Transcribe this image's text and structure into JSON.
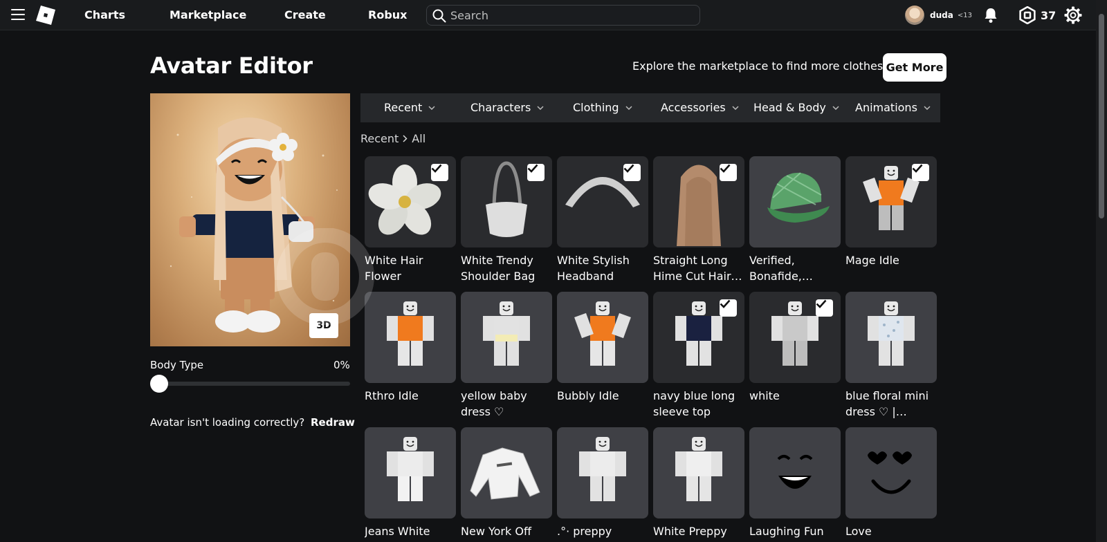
{
  "nav": {
    "links": [
      "Charts",
      "Marketplace",
      "Create",
      "Robux"
    ],
    "search_placeholder": "Search",
    "username": "duda",
    "age_tag": "<13",
    "robux_count": "37"
  },
  "header": {
    "title": "Avatar Editor",
    "explore_text": "Explore the marketplace to find more clothes!",
    "get_more_label": "Get More"
  },
  "preview": {
    "mode_button": "3D",
    "body_type_label": "Body Type",
    "body_type_value": "0%",
    "body_type_level": 0,
    "redraw_text": "Avatar isn't loading correctly?",
    "redraw_link": "Redraw"
  },
  "tabs": [
    "Recent",
    "Characters",
    "Clothing",
    "Accessories",
    "Head & Body",
    "Animations"
  ],
  "breadcrumb": [
    "Recent",
    "All"
  ],
  "items": [
    {
      "name": "White Hair Flower",
      "thumb": "flower-icon",
      "bg": "#2a2b2e",
      "selected": true
    },
    {
      "name": "White Trendy Shoulder Bag",
      "thumb": "bag-icon",
      "bg": "#2a2b2e",
      "selected": true
    },
    {
      "name": "White Stylish Headband",
      "thumb": "headband-icon",
      "bg": "#2a2b2e",
      "selected": true
    },
    {
      "name": "Straight Long Hime Cut Hair…",
      "thumb": "hair-icon",
      "bg": "#2a2b2e",
      "selected": true
    },
    {
      "name": "Verified, Bonafide,…",
      "thumb": "cap-icon",
      "bg": "#3f4045",
      "selected": false
    },
    {
      "name": "Mage Idle",
      "thumb": "mage-idle-icon",
      "bg": "#2a2b2e",
      "selected": true
    },
    {
      "name": "Rthro Idle",
      "thumb": "rthro-idle-icon",
      "bg": "#3f4045",
      "selected": false
    },
    {
      "name": "yellow baby dress ♡ bloxbur…",
      "thumb": "yellow-dress-icon",
      "bg": "#3f4045",
      "selected": false
    },
    {
      "name": "Bubbly Idle",
      "thumb": "bubbly-idle-icon",
      "bg": "#3f4045",
      "selected": false
    },
    {
      "name": "navy blue long sleeve top",
      "thumb": "navy-top-icon",
      "bg": "#2a2b2e",
      "selected": true
    },
    {
      "name": "white",
      "thumb": "white-outfit-icon",
      "bg": "#2a2b2e",
      "selected": true
    },
    {
      "name": "blue floral mini dress ♡ |…",
      "thumb": "floral-dress-icon",
      "bg": "#3f4045",
      "selected": false
    },
    {
      "name": "Jeans White",
      "thumb": "jeans-white-icon",
      "bg": "#3f4045",
      "selected": false
    },
    {
      "name": "New York Off",
      "thumb": "sweater-icon",
      "bg": "#3f4045",
      "selected": false
    },
    {
      "name": ".°·  preppy",
      "thumb": "preppy-outfit-icon",
      "bg": "#3f4045",
      "selected": false
    },
    {
      "name": "White Preppy",
      "thumb": "white-preppy-icon",
      "bg": "#3f4045",
      "selected": false
    },
    {
      "name": "Laughing Fun",
      "thumb": "laughing-face-icon",
      "bg": "#3f4045",
      "selected": false
    },
    {
      "name": "Love",
      "thumb": "love-face-icon",
      "bg": "#3f4045",
      "selected": false
    }
  ],
  "colors": {
    "page_bg": "#111214",
    "topbar_bg": "#191b1d",
    "tab_bar_bg": "#26282b",
    "tile_selected_bg": "#2a2b2e",
    "tile_bg": "#3f4045",
    "accent_orange": "#f07a1e"
  }
}
